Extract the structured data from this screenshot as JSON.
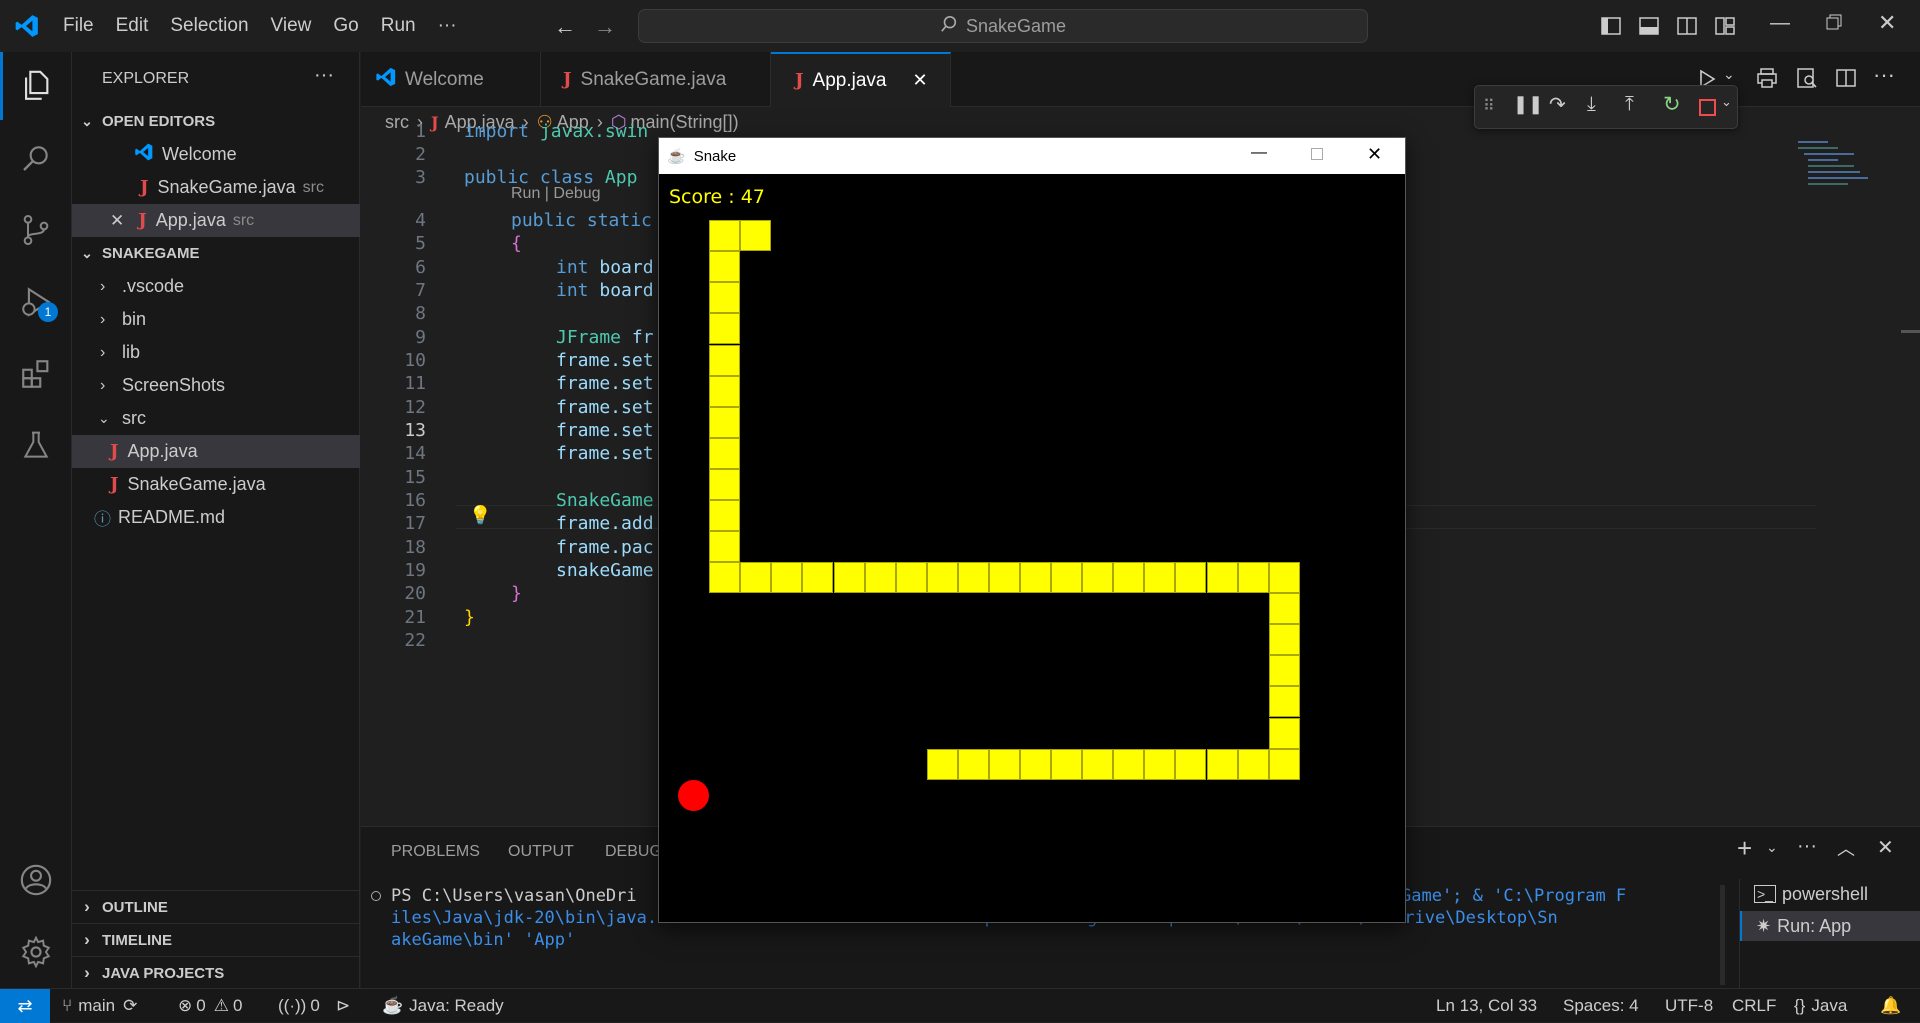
{
  "menu": [
    "File",
    "Edit",
    "Selection",
    "View",
    "Go",
    "Run",
    "···"
  ],
  "command_center": {
    "text": "SnakeGame"
  },
  "explorer": {
    "title": "EXPLORER",
    "more": "···",
    "open_editors_header": "OPEN EDITORS",
    "open_editors": [
      {
        "name": "Welcome",
        "hint": ""
      },
      {
        "name": "SnakeGame.java",
        "hint": "src"
      },
      {
        "name": "App.java",
        "hint": "src"
      }
    ],
    "project_header": "SNAKEGAME",
    "tree": [
      ".vscode",
      "bin",
      "lib",
      "ScreenShots",
      "src",
      "App.java",
      "SnakeGame.java",
      "README.md"
    ],
    "outline": "OUTLINE",
    "timeline": "TIMELINE",
    "java_projects": "JAVA PROJECTS"
  },
  "badges": {
    "debug_count": "1"
  },
  "tabs": [
    {
      "label": "Welcome"
    },
    {
      "label": "SnakeGame.java"
    },
    {
      "label": "App.java"
    }
  ],
  "breadcrumb": {
    "folder": "src",
    "file": "App.java",
    "cls": "App",
    "method": "main(String[])"
  },
  "codelens": "Run | Debug",
  "line_numbers": [
    "1",
    "2",
    "3",
    "4",
    "5",
    "6",
    "7",
    "8",
    "9",
    "10",
    "11",
    "12",
    "13",
    "14",
    "15",
    "16",
    "17",
    "18",
    "19",
    "20",
    "21",
    "22"
  ],
  "code": {
    "l1a": "import ",
    "l1b": "javax.swin",
    "l3a": "public class ",
    "l3b": "App",
    "l4": "public static",
    "l5": "{",
    "l6a": "int ",
    "l6b": "board",
    "l7a": "int ",
    "l7b": "board",
    "l9a": "JFrame ",
    "l9b": "fr",
    "l10": "frame.set",
    "l11": "frame.set",
    "l12": "frame.set",
    "l13": "frame.set",
    "l14": "frame.set",
    "l16": "SnakeGame",
    "l17": "frame.add",
    "l18": "frame.pac",
    "l19": "snakeGame",
    "l20": "}",
    "l21": "}"
  },
  "panel": {
    "tabs": [
      "PROBLEMS",
      "OUTPUT",
      "DEBUG"
    ],
    "terminal_line1a": "PS C:\\Users\\vasan\\OneDri",
    "terminal_line1b": "Game'; & 'C:\\Program F",
    "terminal_line2": "iles\\Java\\jdk-20\\bin\\java.exe' '-XX:+ShowCodeDetailsInExceptionMessages' '-cp' 'C:\\Users\\vasan\\OneDrive\\Desktop\\Sn",
    "terminal_line3": "akeGame\\bin' 'App'",
    "terminals": [
      "powershell",
      "Run: App"
    ]
  },
  "statusbar": {
    "branch": "main",
    "errors": "0",
    "warnings": "0",
    "ports": "0",
    "java": "Java: Ready",
    "position": "Ln 13, Col 33",
    "spaces": "Spaces: 4",
    "encoding": "UTF-8",
    "eol": "CRLF",
    "lang": "Java"
  },
  "snake_window": {
    "title": "Snake",
    "score": "Score : 47"
  },
  "game": {
    "snake_color": "#ffff00",
    "food_color": "#ff0000",
    "grid_cols": 24,
    "snake_cells": [
      [
        2,
        2
      ],
      [
        3,
        2
      ],
      [
        2,
        3
      ],
      [
        2,
        4
      ],
      [
        2,
        5
      ],
      [
        2,
        6
      ],
      [
        2,
        7
      ],
      [
        2,
        8
      ],
      [
        2,
        9
      ],
      [
        2,
        10
      ],
      [
        2,
        11
      ],
      [
        2,
        12
      ],
      [
        2,
        13
      ],
      [
        3,
        13
      ],
      [
        4,
        13
      ],
      [
        5,
        13
      ],
      [
        6,
        13
      ],
      [
        7,
        13
      ],
      [
        8,
        13
      ],
      [
        9,
        13
      ],
      [
        10,
        13
      ],
      [
        11,
        13
      ],
      [
        12,
        13
      ],
      [
        13,
        13
      ],
      [
        14,
        13
      ],
      [
        15,
        13
      ],
      [
        16,
        13
      ],
      [
        17,
        13
      ],
      [
        18,
        13
      ],
      [
        19,
        13
      ],
      [
        20,
        13
      ],
      [
        20,
        14
      ],
      [
        20,
        15
      ],
      [
        20,
        16
      ],
      [
        20,
        17
      ],
      [
        20,
        18
      ],
      [
        20,
        19
      ],
      [
        19,
        19
      ],
      [
        18,
        19
      ],
      [
        17,
        19
      ],
      [
        16,
        19
      ],
      [
        15,
        19
      ],
      [
        14,
        19
      ],
      [
        13,
        19
      ],
      [
        12,
        19
      ],
      [
        11,
        19
      ],
      [
        10,
        19
      ],
      [
        9,
        19
      ]
    ],
    "food_cell": [
      1,
      20
    ]
  }
}
